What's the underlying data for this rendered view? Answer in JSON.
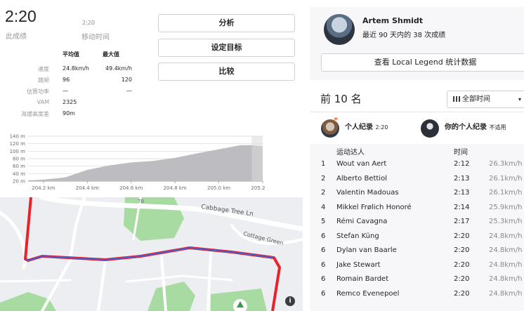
{
  "summary": {
    "elapsed_time": "2:20",
    "elapsed_label": "此成绩",
    "moving_time": "2:20",
    "moving_label": "移动时间"
  },
  "stats": {
    "avg_header": "平均值",
    "max_header": "最大值",
    "rows": [
      {
        "label": "速度",
        "avg": "24.8km/h",
        "max": "49.4km/h"
      },
      {
        "label": "踏频",
        "avg": "96",
        "max": "120"
      },
      {
        "label": "估算功率",
        "avg": "—",
        "max": "—"
      },
      {
        "label": "VAM",
        "avg": "2325",
        "max": ""
      },
      {
        "label": "海拔高度差",
        "avg": "90m",
        "max": ""
      }
    ]
  },
  "actions": {
    "analyze": "分析",
    "set_goal": "设定目标",
    "compare": "比较"
  },
  "elevation_chart": {
    "y_ticks": [
      "140 m",
      "120 m",
      "100 m",
      "80 m",
      "60 m",
      "40 m",
      "20 m"
    ],
    "x_ticks": [
      "204.2 km",
      "204.4 km",
      "204.6 km",
      "204.8 km",
      "205.0 km",
      "205.2 km"
    ],
    "x_range": [
      204.13,
      205.2
    ],
    "y_range": [
      20,
      140
    ],
    "profile_km": [
      204.13,
      204.2,
      204.3,
      204.4,
      204.5,
      204.6,
      204.7,
      204.8,
      204.9,
      205.0,
      205.1,
      205.15,
      205.2
    ],
    "profile_m": [
      22,
      24,
      30,
      50,
      62,
      70,
      74,
      82,
      94,
      105,
      116,
      116,
      113
    ],
    "colors": {
      "fill": "#bdbdc1",
      "highlight": "#dadadd",
      "grid": "#d8d8dc"
    }
  },
  "map": {
    "street_cabbage": "Cabbage Tree Ln",
    "street_cottage": "Cottage Green",
    "street_small": "70",
    "route_color": "#e6242a",
    "effort_color": "#4a5bcf",
    "park_color": "#a7dba1",
    "info_icon": "i"
  },
  "athlete": {
    "name": "Artem Shmidt",
    "subtitle": "最近 90 天内的 38 次成绩",
    "legend_button": "查看 Local Legend 统计数据"
  },
  "leaderboard": {
    "title": "前 10 名",
    "filter_label": "全部时间",
    "pr_label": "个人纪录",
    "pr_time": "2:20",
    "your_pr_label": "你的个人纪录",
    "your_pr_value": "不适用",
    "col_athlete": "运动达人",
    "col_time": "时间",
    "rows": [
      {
        "rank": "1",
        "name": "Wout van Aert",
        "time": "2:12",
        "speed": "26.3km/h"
      },
      {
        "rank": "2",
        "name": "Alberto Bettiol",
        "time": "2:13",
        "speed": "26.1km/h"
      },
      {
        "rank": "2",
        "name": "Valentin Madouas",
        "time": "2:13",
        "speed": "26.1km/h"
      },
      {
        "rank": "4",
        "name": "Mikkel Frølich Honoré",
        "time": "2:14",
        "speed": "25.9km/h"
      },
      {
        "rank": "5",
        "name": "Rémi Cavagna",
        "time": "2:17",
        "speed": "25.3km/h"
      },
      {
        "rank": "6",
        "name": "Stefan Küng",
        "time": "2:20",
        "speed": "24.8km/h"
      },
      {
        "rank": "6",
        "name": "Dylan van Baarle",
        "time": "2:20",
        "speed": "24.8km/h"
      },
      {
        "rank": "6",
        "name": "Jake Stewart",
        "time": "2:20",
        "speed": "24.8km/h"
      },
      {
        "rank": "6",
        "name": "Romain Bardet",
        "time": "2:20",
        "speed": "24.8km/h"
      },
      {
        "rank": "6",
        "name": "Remco Evenepoel",
        "time": "2:20",
        "speed": "24.8km/h"
      }
    ]
  }
}
